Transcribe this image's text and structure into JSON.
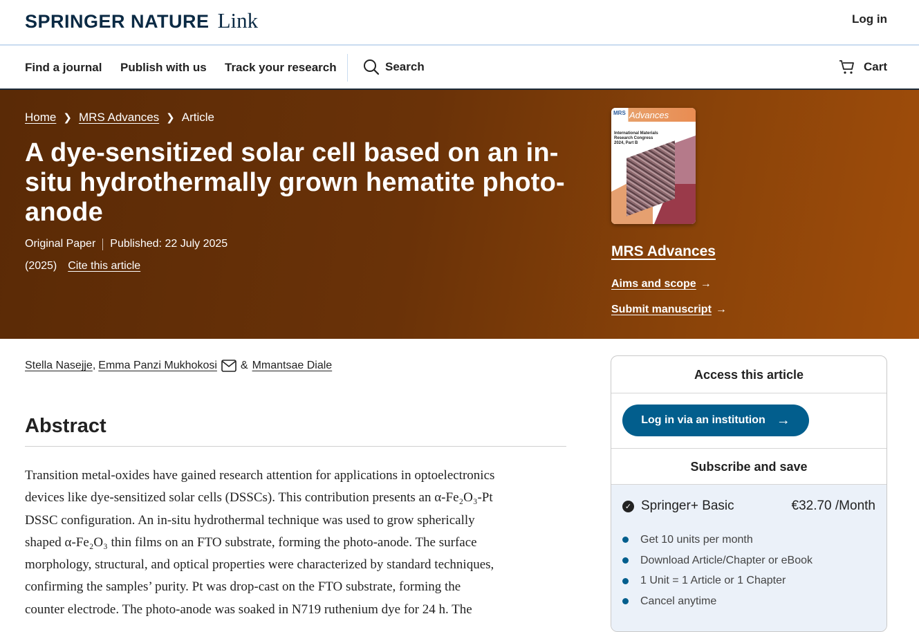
{
  "header": {
    "brand": "SPRINGER NATURE",
    "brand_suffix": "Link",
    "login": "Log in"
  },
  "nav": {
    "items": [
      "Find a journal",
      "Publish with us",
      "Track your research"
    ],
    "search": "Search",
    "cart": "Cart"
  },
  "breadcrumb": {
    "home": "Home",
    "journal": "MRS Advances",
    "current": "Article"
  },
  "article": {
    "title": "A dye-sensitized solar cell based on an in-situ hydrothermally grown hematite photo-anode",
    "type": "Original Paper",
    "published": "Published: 22 July 2025",
    "year": "(2025)",
    "cite": "Cite this article",
    "authors": [
      "Stella Nasejje",
      "Emma Panzi Mukhokosi",
      "Mmantsae Diale"
    ],
    "author_sep1": ",",
    "author_amp": "&"
  },
  "journal": {
    "cover_brand": "MRS",
    "cover_title": "Advances",
    "cover_text": "International Materials Research Congress 2024, Part B",
    "name": "MRS Advances",
    "aims": "Aims and scope",
    "submit": "Submit manuscript",
    "arrow": "→"
  },
  "abstract": {
    "heading": "Abstract",
    "lines": [
      "Transition metal-oxides have gained research attention for applications in optoelectronics",
      "devices like dye-sensitized solar cells (DSSCs). This contribution presents an α-Fe₂O₃-Pt",
      "DSSC configuration. An in-situ hydrothermal technique was used to grow spherically",
      "shaped α-Fe₂O₃ thin films on an FTO substrate, forming the photo-anode. The surface",
      "morphology, structural, and optical properties were characterized by standard techniques,",
      "confirming the samples’ purity. Pt was drop-cast on the FTO substrate, forming the",
      "counter electrode. The photo-anode was soaked in N719 ruthenium dye for 24 h. The"
    ]
  },
  "access": {
    "heading": "Access this article",
    "institution_button": "Log in via an institution",
    "subscribe_heading": "Subscribe and save",
    "plan_name": "Springer+ Basic",
    "plan_price": "€32.70 /Month",
    "features": [
      "Get 10 units per month",
      "Download Article/Chapter or eBook",
      "1 Unit = 1 Article or 1 Chapter",
      "Cancel anytime"
    ],
    "accent_color": "#025e8d"
  }
}
